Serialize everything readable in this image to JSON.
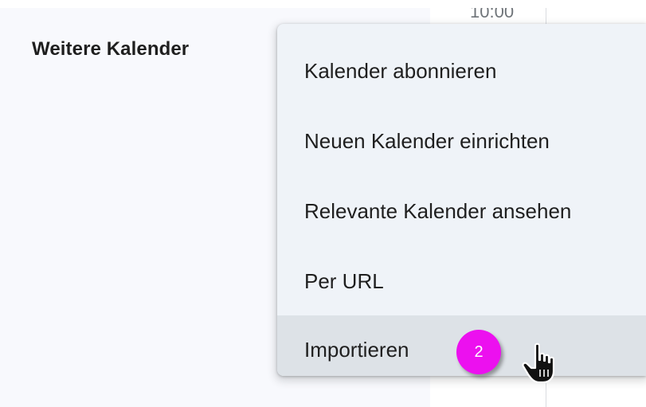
{
  "sidebar": {
    "section_title": "Weitere Kalender"
  },
  "calendar_grid": {
    "time_fragment": "10:00"
  },
  "menu": {
    "items": [
      {
        "label": "Kalender abonnieren"
      },
      {
        "label": "Neuen Kalender einrichten"
      },
      {
        "label": "Relevante Kalender ansehen"
      },
      {
        "label": "Per URL"
      },
      {
        "label": "Importieren",
        "highlighted": true
      }
    ]
  },
  "annotation": {
    "step_number": "2"
  },
  "colors": {
    "badge": "#ec10ef",
    "menu_background": "#eff3f8",
    "highlight": "#dde2e7",
    "sidebar_background": "#f8f9fd"
  },
  "icons": {
    "cursor": "pointing-hand-cursor-icon"
  }
}
